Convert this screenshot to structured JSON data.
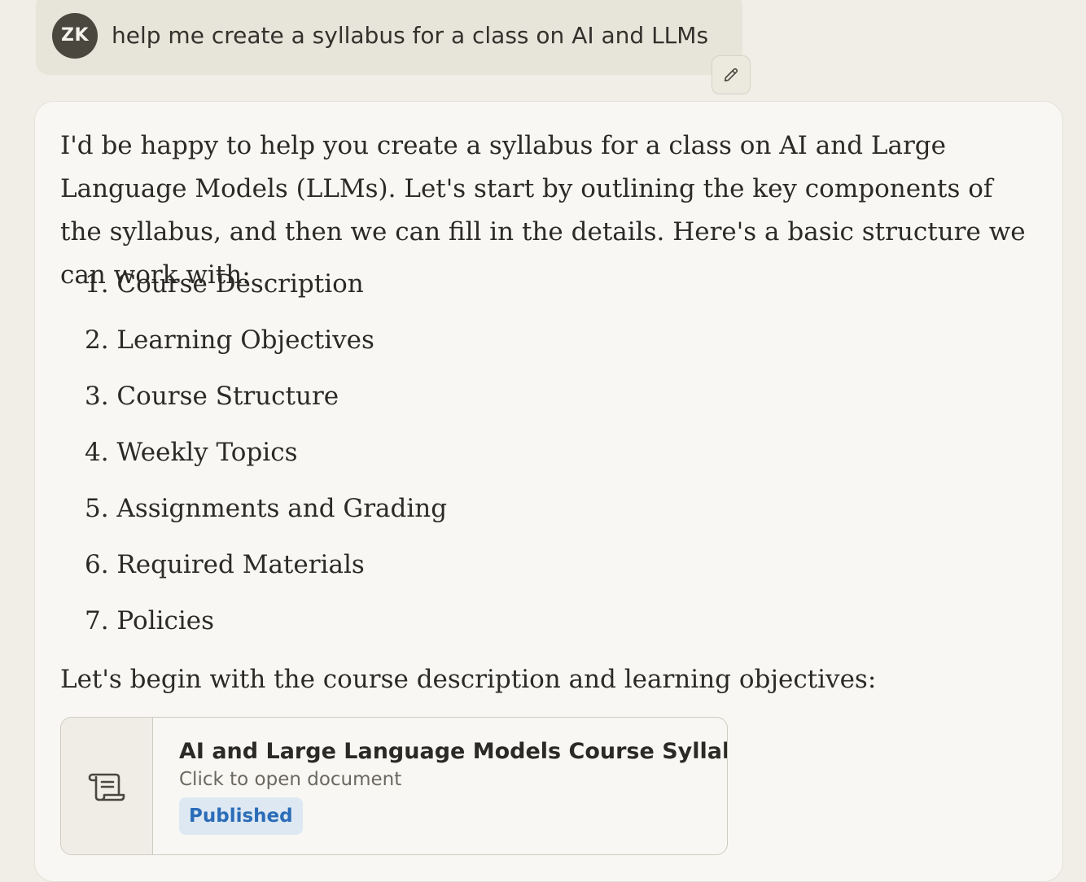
{
  "user_message": {
    "avatar_initials": "ZK",
    "text": "help me create a syllabus for a class on AI and LLMs",
    "edit_icon": "pencil-icon"
  },
  "assistant": {
    "intro": "I'd be happy to help you create a syllabus for a class on AI and Large Language Models (LLMs). Let's start by outlining the key components of the syllabus, and then we can fill in the details. Here's a basic structure we can work with:",
    "outline": [
      "1. Course Description",
      "2. Learning Objectives",
      "3. Course Structure",
      "4. Weekly Topics",
      "5. Assignments and Grading",
      "6. Required Materials",
      "7. Policies"
    ],
    "followup": "Let's begin with the course description and learning objectives:",
    "artifact": {
      "icon": "scroll-document-icon",
      "title": "AI and Large Language Models Course Syllabus",
      "subtitle": "Click to open document",
      "status": "Published"
    }
  },
  "colors": {
    "page_background": "#f0eee6",
    "user_bubble": "#e7e4d9",
    "avatar": "#4a473f",
    "assistant_card": "#f8f7f3",
    "badge_background": "#dde8f3",
    "badge_text": "#2b6cb8"
  }
}
